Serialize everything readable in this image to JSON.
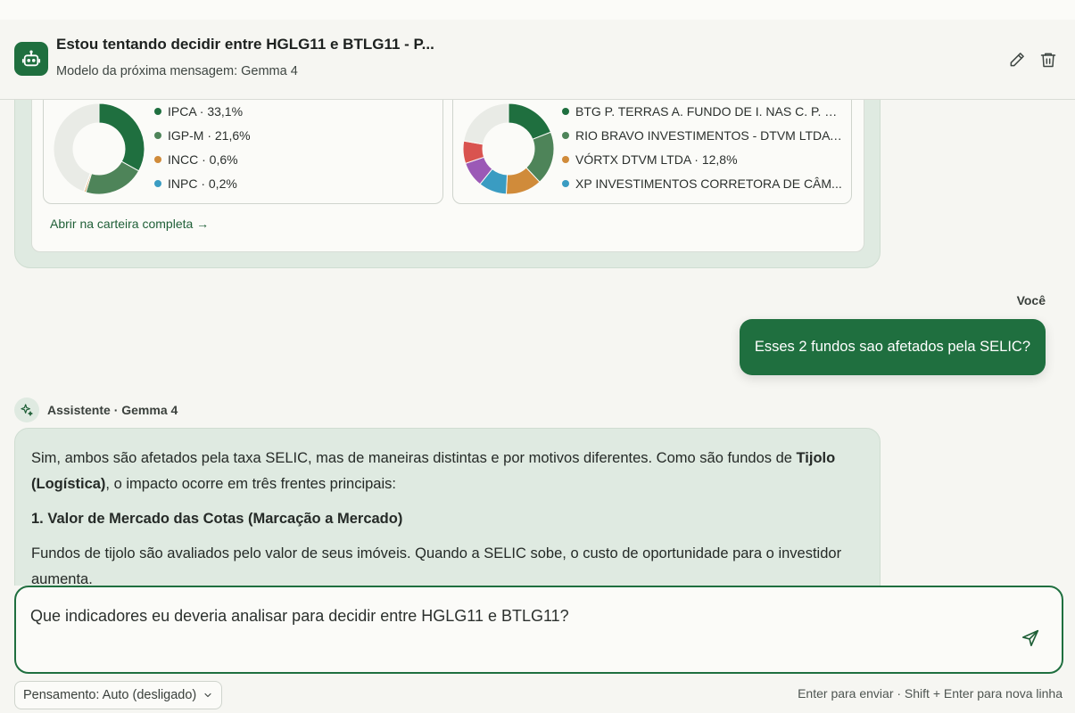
{
  "header": {
    "title": "Estou tentando decidir entre HGLG11 e BTLG11 - P...",
    "model_line": "Modelo da próxima mensagem: Gemma 4"
  },
  "previous_message": {
    "charts": [
      {
        "legend": [
          {
            "label": "IPCA · 33,1%",
            "color": "#1f6f3f"
          },
          {
            "label": "IGP-M · 21,6%",
            "color": "#4e8459"
          },
          {
            "label": "INCC · 0,6%",
            "color": "#d08b3a"
          },
          {
            "label": "INPC · 0,2%",
            "color": "#3a9cc2"
          }
        ],
        "slices": [
          {
            "value": 33.1,
            "color": "#1f6f3f"
          },
          {
            "value": 21.6,
            "color": "#4e8459"
          },
          {
            "value": 0.6,
            "color": "#d08b3a"
          },
          {
            "value": 0.2,
            "color": "#3a9cc2"
          },
          {
            "value": 44.5,
            "color": "#e9ebe6"
          }
        ]
      },
      {
        "legend": [
          {
            "label": "BTG P. TERRAS A. FUNDO DE I. NAS C. P. DO ...",
            "color": "#1f6f3f"
          },
          {
            "label": "RIO BRAVO INVESTIMENTOS - DTVM LTDA · ...",
            "color": "#4e8459"
          },
          {
            "label": "VÓRTX DTVM LTDA · 12,8%",
            "color": "#d08b3a"
          },
          {
            "label": "XP INVESTIMENTOS CORRETORA DE CÂM...",
            "color": "#3a9cc2"
          }
        ],
        "slices": [
          {
            "value": 19,
            "color": "#1f6f3f"
          },
          {
            "value": 19,
            "color": "#4e8459"
          },
          {
            "value": 12.8,
            "color": "#d08b3a"
          },
          {
            "value": 10,
            "color": "#3a9cc2"
          },
          {
            "value": 9,
            "color": "#9b59b6"
          },
          {
            "value": 8,
            "color": "#d9534f"
          },
          {
            "value": 22.2,
            "color": "#e9ebe6"
          }
        ]
      }
    ],
    "open_link": "Abrir na carteira completa →"
  },
  "user_message": {
    "label": "Você",
    "text": "Esses 2 fundos sao afetados pela SELIC?"
  },
  "assistant": {
    "label": "Assistente · Gemma 4",
    "p1_start": "Sim, ambos são afetados pela taxa SELIC, mas de maneiras distintas e por motivos diferentes. Como são fundos de ",
    "p1_bold": "Tijolo (Logística)",
    "p1_end": ", o impacto ocorre em três frentes principais:",
    "heading": "1. Valor de Mercado das Cotas (Marcação a Mercado)",
    "p2": "Fundos de tijolo são avaliados pelo valor de seus imóveis. Quando a SELIC sobe, o custo de oportunidade para o investidor aumenta."
  },
  "composer": {
    "text": "Que indicadores eu deveria analisar para decidir entre HGLG11 e BTLG11?"
  },
  "footer": {
    "thinking_label": "Pensamento: Auto (desligado)",
    "hint": "Enter para enviar · Shift + Enter para nova linha"
  },
  "colors": {
    "accent": "#1f6f3f",
    "bubble": "#dfeae1"
  },
  "icons": {
    "avatar": "robot-icon",
    "edit": "pencil-icon",
    "delete": "trash-icon",
    "assistant": "sparkle-icon",
    "send": "send-icon",
    "dropdown": "chevron-down-icon"
  }
}
